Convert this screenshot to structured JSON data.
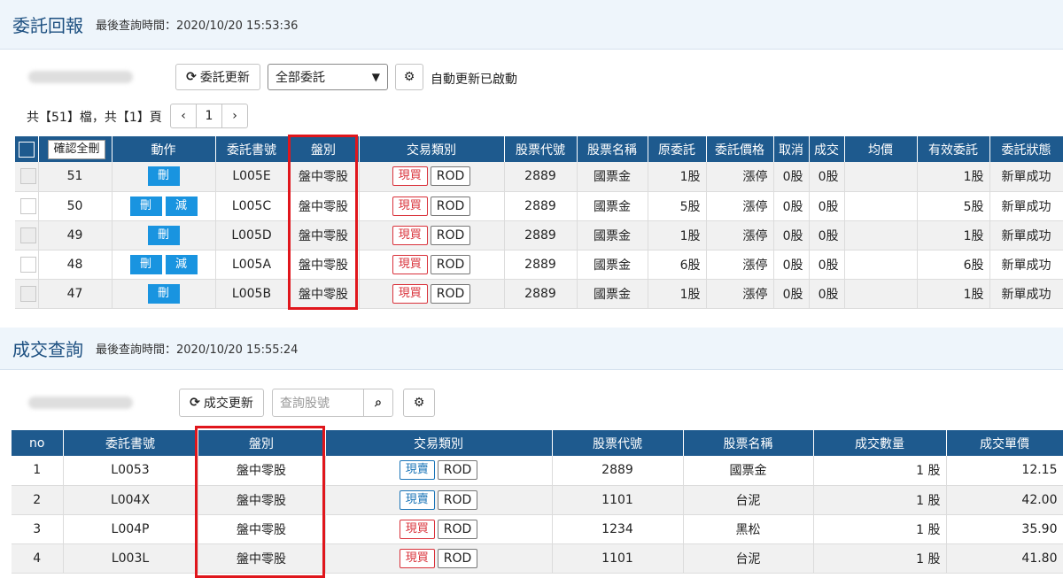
{
  "orders": {
    "title": "委託回報",
    "last_query": "最後查詢時間：2020/10/20 15:53:36",
    "refresh_label": "委託更新",
    "filter_selected": "全部委託",
    "auto_refresh_text": "自動更新已啟動",
    "pagination": {
      "summary": "共【51】檔，共【1】頁",
      "prev": "‹",
      "page": "1",
      "next": "›"
    },
    "confirm_all_label": "確認全刪",
    "columns": [
      "動作",
      "委託書號",
      "盤別",
      "交易類別",
      "股票代號",
      "股票名稱",
      "原委託",
      "委託價格",
      "取消",
      "成交",
      "均價",
      "有效委託",
      "委託狀態"
    ],
    "rows": [
      {
        "no": "51",
        "actions": [
          "刪"
        ],
        "order_id": "L005E",
        "session": "盤中零股",
        "side": "現買",
        "tif": "ROD",
        "code": "2889",
        "name": "國票金",
        "orig_qty": "1股",
        "price": "漲停",
        "cancel": "0股",
        "filled": "0股",
        "avg": "",
        "valid": "1股",
        "status": "新單成功"
      },
      {
        "no": "50",
        "actions": [
          "刪",
          "減"
        ],
        "order_id": "L005C",
        "session": "盤中零股",
        "side": "現買",
        "tif": "ROD",
        "code": "2889",
        "name": "國票金",
        "orig_qty": "5股",
        "price": "漲停",
        "cancel": "0股",
        "filled": "0股",
        "avg": "",
        "valid": "5股",
        "status": "新單成功"
      },
      {
        "no": "49",
        "actions": [
          "刪"
        ],
        "order_id": "L005D",
        "session": "盤中零股",
        "side": "現買",
        "tif": "ROD",
        "code": "2889",
        "name": "國票金",
        "orig_qty": "1股",
        "price": "漲停",
        "cancel": "0股",
        "filled": "0股",
        "avg": "",
        "valid": "1股",
        "status": "新單成功"
      },
      {
        "no": "48",
        "actions": [
          "刪",
          "減"
        ],
        "order_id": "L005A",
        "session": "盤中零股",
        "side": "現買",
        "tif": "ROD",
        "code": "2889",
        "name": "國票金",
        "orig_qty": "6股",
        "price": "漲停",
        "cancel": "0股",
        "filled": "0股",
        "avg": "",
        "valid": "6股",
        "status": "新單成功"
      },
      {
        "no": "47",
        "actions": [
          "刪"
        ],
        "order_id": "L005B",
        "session": "盤中零股",
        "side": "現買",
        "tif": "ROD",
        "code": "2889",
        "name": "國票金",
        "orig_qty": "1股",
        "price": "漲停",
        "cancel": "0股",
        "filled": "0股",
        "avg": "",
        "valid": "1股",
        "status": "新單成功"
      }
    ]
  },
  "trades": {
    "title": "成交查詢",
    "last_query": "最後查詢時間：2020/10/20 15:55:24",
    "refresh_label": "成交更新",
    "search_placeholder": "查詢股號",
    "columns": [
      "no",
      "委託書號",
      "盤別",
      "交易類別",
      "股票代號",
      "股票名稱",
      "成交數量",
      "成交單價"
    ],
    "rows": [
      {
        "no": "1",
        "order_id": "L0053",
        "session": "盤中零股",
        "side": "現賣",
        "side_color": "blue",
        "tif": "ROD",
        "code": "2889",
        "name": "國票金",
        "qty": "1 股",
        "price": "12.15"
      },
      {
        "no": "2",
        "order_id": "L004X",
        "session": "盤中零股",
        "side": "現賣",
        "side_color": "blue",
        "tif": "ROD",
        "code": "1101",
        "name": "台泥",
        "qty": "1 股",
        "price": "42.00"
      },
      {
        "no": "3",
        "order_id": "L004P",
        "session": "盤中零股",
        "side": "現買",
        "side_color": "red",
        "tif": "ROD",
        "code": "1234",
        "name": "黑松",
        "qty": "1 股",
        "price": "35.90"
      },
      {
        "no": "4",
        "order_id": "L003L",
        "session": "盤中零股",
        "side": "現買",
        "side_color": "red",
        "tif": "ROD",
        "code": "1101",
        "name": "台泥",
        "qty": "1 股",
        "price": "41.80"
      }
    ]
  },
  "colors": {
    "header_bg": "#1e5a8e",
    "title": "#1c4f80",
    "action_btn": "#1994e0",
    "buy": "#d9313a",
    "sell": "#1b75b8",
    "highlight": "#e0161c"
  }
}
